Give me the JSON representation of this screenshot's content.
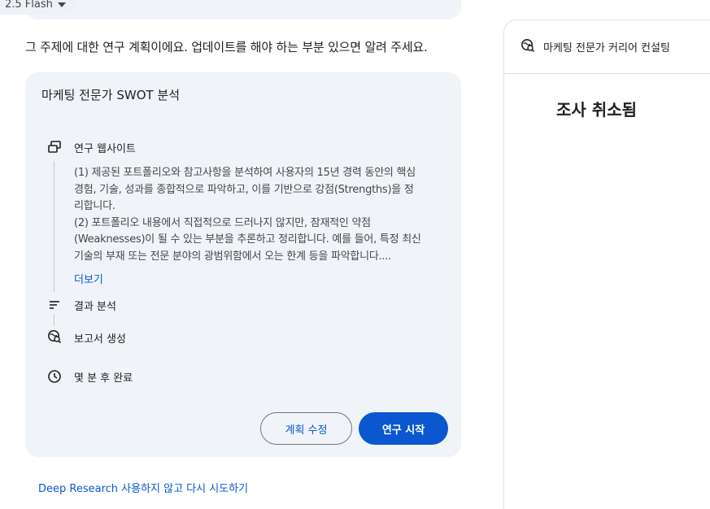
{
  "model_selector": {
    "label": "2.5 Flash"
  },
  "intro_text": "그 주제에 대한 연구 계획이에요. 업데이트를 해야 하는 부분 있으면 알려 주세요.",
  "plan": {
    "title": "마케팅 전문가 SWOT 분석",
    "steps": [
      {
        "icon": "website-icon",
        "label": "연구 웹사이트"
      },
      {
        "icon": "analysis-icon",
        "label": "결과 분석"
      },
      {
        "icon": "report-icon",
        "label": "보고서 생성"
      },
      {
        "icon": "clock-icon",
        "label": "몇 분 후 완료"
      }
    ],
    "description_lines": [
      "(1) 제공된 포트폴리오와 참고사항을 분석하여 사용자의 15년 경력 동안의 핵심",
      "경험, 기술, 성과를 종합적으로 파악하고, 이를 기반으로 강점(Strengths)을 정",
      "리합니다.",
      "(2) 포트폴리오 내용에서 직접적으로 드러나지 않지만, 잠재적인 약점",
      "(Weaknesses)이 될 수 있는 부분을 추론하고 정리합니다. 예를 들어, 특정 최신",
      "기술의 부재 또는 전문 분야의 광범위함에서 오는 한계 등을 파악합니다...."
    ],
    "more_label": "더보기",
    "edit_button": "계획 수정",
    "start_button": "연구 시작"
  },
  "retry_link": "Deep Research 사용하지 않고 다시 시도하기",
  "side_panel": {
    "title": "마케팅 전문가 커리어 컨설팅",
    "status": "조사 취소됨"
  },
  "colors": {
    "accent": "#0b57d0",
    "card_bg": "#f0f4f9",
    "border": "#e3e3e3"
  }
}
